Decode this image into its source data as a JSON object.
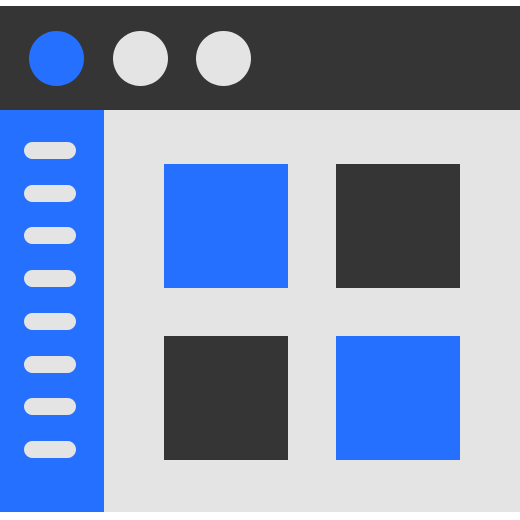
{
  "colors": {
    "titlebar": "#353535",
    "sidebar": "#2570fe",
    "main": "#e4e4e4",
    "accent": "#2570fe",
    "dark": "#353535",
    "light": "#e4e4e4"
  },
  "titlebar": {
    "dots": [
      {
        "name": "active-window-dot",
        "color": "#2570fe"
      },
      {
        "name": "inactive-window-dot-1",
        "color": "#e4e4e4"
      },
      {
        "name": "inactive-window-dot-2",
        "color": "#e4e4e4"
      }
    ]
  },
  "sidebar": {
    "item_count": 8,
    "item_color": "#e4e4e4"
  },
  "main": {
    "tiles": [
      {
        "name": "tile-top-left",
        "color": "#2570fe"
      },
      {
        "name": "tile-top-right",
        "color": "#353535"
      },
      {
        "name": "tile-bottom-left",
        "color": "#353535"
      },
      {
        "name": "tile-bottom-right",
        "color": "#2570fe"
      }
    ]
  }
}
